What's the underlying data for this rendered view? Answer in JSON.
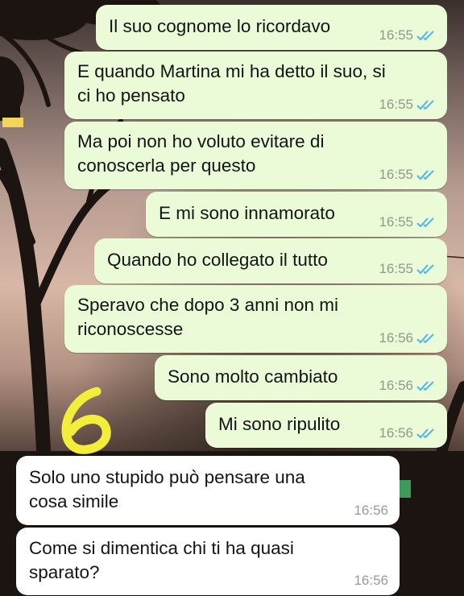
{
  "messages": [
    {
      "text": "Il suo cognome lo ricordavo",
      "time": "16:55",
      "direction": "outgoing",
      "status": "read"
    },
    {
      "text": "E quando Martina mi ha detto il suo, si\nci ho pensato",
      "time": "16:55",
      "direction": "outgoing",
      "status": "read"
    },
    {
      "text": "Ma poi non ho voluto evitare di\nconoscerla per questo",
      "time": "16:55",
      "direction": "outgoing",
      "status": "read"
    },
    {
      "text": "E mi sono innamorato",
      "time": "16:55",
      "direction": "outgoing",
      "status": "read"
    },
    {
      "text": "Quando ho collegato il tutto",
      "time": "16:55",
      "direction": "outgoing",
      "status": "read"
    },
    {
      "text": "Speravo che dopo 3 anni non mi\nriconoscesse",
      "time": "16:56",
      "direction": "outgoing",
      "status": "read"
    },
    {
      "text": "Sono molto cambiato",
      "time": "16:56",
      "direction": "outgoing",
      "status": "read"
    },
    {
      "text": "Mi sono ripulito",
      "time": "16:56",
      "direction": "outgoing",
      "status": "read"
    },
    {
      "text": "Solo uno stupido può pensare una\ncosa simile",
      "time": "16:56",
      "direction": "incoming"
    },
    {
      "text": "Come si dimentica chi ti ha quasi\nsparato?",
      "time": "16:56",
      "direction": "incoming"
    }
  ],
  "overlay_annotation": "6",
  "colors": {
    "outgoing_bubble": "#ebfbd8",
    "incoming_bubble": "#ffffff",
    "read_ticks": "#4fb6ec",
    "annotation": "#f2ee3a"
  },
  "icons": {
    "read_receipt": "double-check-icon"
  }
}
